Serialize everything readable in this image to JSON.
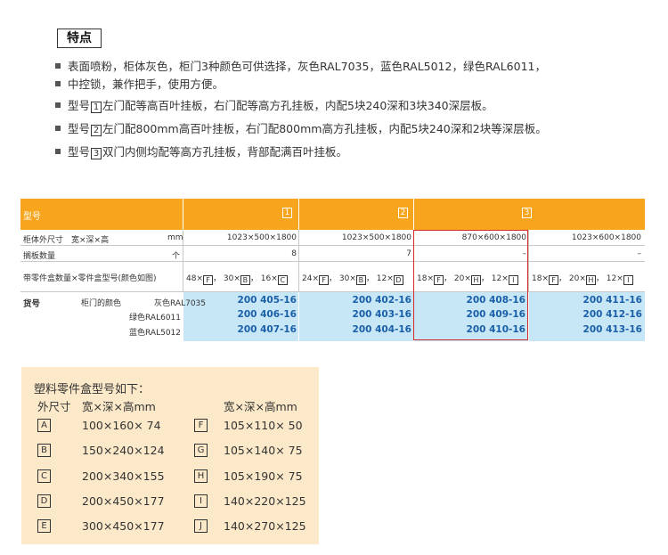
{
  "features": {
    "title": "特点",
    "line1": "表面喷粉，柜体灰色，柜门3种颜色可供选择，灰色RAL7035，蓝色RAL5012，绿色RAL6011，",
    "line2": "中控锁，兼作把手，使用方便。",
    "line3_pre": "型号",
    "line3_num": "1",
    "line3_post": "左门配等高百叶挂板，右门配等高方孔挂板，内配5块240深和3块340深层板。",
    "line4_pre": "型号",
    "line4_num": "2",
    "line4_post": "左门配800mm高百叶挂板，右门配800mm高方孔挂板，内配5块240深和2块等深层板。",
    "line5_pre": "型号",
    "line5_num": "3",
    "line5_post": "双门内侧均配等高方孔挂板，背部配满百叶挂板。"
  },
  "table": {
    "header": {
      "model_label": "型号",
      "m1": "1",
      "m2": "2",
      "m3": "3"
    },
    "dims": {
      "label": "柜体外尺寸　宽×深×高",
      "unit": "mm",
      "v1": "1023×500×1800",
      "v2": "1023×500×1800",
      "v3": "870×600×1800",
      "v4": "1023×600×1800"
    },
    "shelves": {
      "label": "搁板数量",
      "unit": "个",
      "v1": "8",
      "v2": "7",
      "v3": "–",
      "v4": "–"
    },
    "bins": {
      "label": "带零件盒数量×零件盒型号(颜色如图)",
      "c1": [
        {
          "n": "48×",
          "b": "F",
          "s": "，"
        },
        {
          "n": "30×",
          "b": "B",
          "s": "，"
        },
        {
          "n": "16×",
          "b": "C",
          "s": ""
        }
      ],
      "c2": [
        {
          "n": "24×",
          "b": "F",
          "s": "，"
        },
        {
          "n": "30×",
          "b": "B",
          "s": "，"
        },
        {
          "n": "12×",
          "b": "D",
          "s": ""
        }
      ],
      "c3": [
        {
          "n": "18×",
          "b": "F",
          "s": "，"
        },
        {
          "n": "20×",
          "b": "H",
          "s": "，"
        },
        {
          "n": "12×",
          "b": "I",
          "s": ""
        }
      ],
      "c4": [
        {
          "n": "18×",
          "b": "F",
          "s": "，"
        },
        {
          "n": "20×",
          "b": "H",
          "s": "，"
        },
        {
          "n": "12×",
          "b": "I",
          "s": ""
        }
      ]
    },
    "goods": {
      "label": "货号",
      "door_label": "柜门的颜色",
      "colors": [
        "灰色RAL7035",
        "绿色RAL6011",
        "蓝色RAL5012"
      ],
      "col1": [
        "200 405-16",
        "200 406-16",
        "200 407-16"
      ],
      "col2": [
        "200 402-16",
        "200 403-16",
        "200 404-16"
      ],
      "col3": [
        "200 408-16",
        "200 409-16",
        "200 410-16"
      ],
      "col4": [
        "200 411-16",
        "200 412-16",
        "200 413-16"
      ]
    }
  },
  "boxes": {
    "title": "塑料零件盒型号如下：",
    "col_outer": "外尺寸",
    "col_dims": "宽×深×高mm",
    "col_dims2": "宽×深×高mm",
    "left": [
      {
        "id": "A",
        "dims": "100×160×  74"
      },
      {
        "id": "B",
        "dims": "150×240×124"
      },
      {
        "id": "C",
        "dims": "200×340×155"
      },
      {
        "id": "D",
        "dims": "200×450×177"
      },
      {
        "id": "E",
        "dims": "300×450×177"
      }
    ],
    "right": [
      {
        "id": "F",
        "dims": "105×110×  50"
      },
      {
        "id": "G",
        "dims": "105×140×  75"
      },
      {
        "id": "H",
        "dims": "105×190×  75"
      },
      {
        "id": "I",
        "dims": "140×220×125"
      },
      {
        "id": "J",
        "dims": "140×270×125"
      }
    ]
  }
}
